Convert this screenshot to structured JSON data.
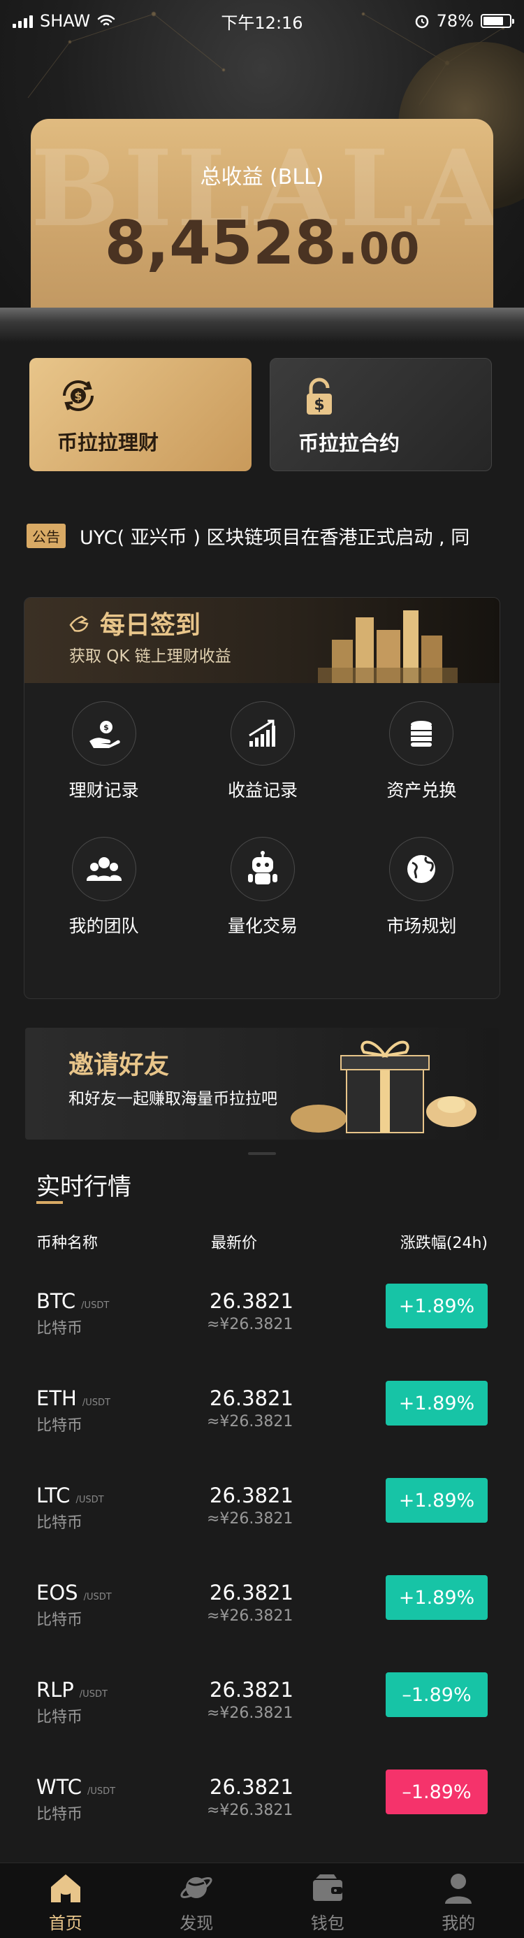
{
  "status": {
    "carrier": "SHAW",
    "time": "下午12:16",
    "battery": "78%",
    "battery_level": 0.78
  },
  "hero": {
    "watermark": "BILALA",
    "label": "总收益 (BLL)",
    "value_int": "8,4528.",
    "value_dec": "00"
  },
  "products": [
    {
      "label": "币拉拉理财",
      "icon": "dollar-cycle-icon"
    },
    {
      "label": "币拉拉合约",
      "icon": "lock-dollar-icon"
    }
  ],
  "notice": {
    "tag": "公告",
    "text": "UYC( 亚兴币 ) 区块链项目在香港正式启动 , 同"
  },
  "signin": {
    "title": "每日签到",
    "subtitle": "获取 QK 链上理财收益"
  },
  "grid": [
    {
      "label": "理财记录",
      "icon": "hand-coin-icon"
    },
    {
      "label": "收益记录",
      "icon": "growth-chart-icon"
    },
    {
      "label": "资产兑换",
      "icon": "coin-stack-icon"
    },
    {
      "label": "我的团队",
      "icon": "team-icon"
    },
    {
      "label": "量化交易",
      "icon": "robot-icon"
    },
    {
      "label": "市场规划",
      "icon": "globe-icon"
    }
  ],
  "invite": {
    "title": "邀请好友",
    "subtitle": "和好友一起赚取海量币拉拉吧"
  },
  "market": {
    "title": "实时行情",
    "headers": {
      "name": "币种名称",
      "price": "最新价",
      "change": "涨跌幅(24h)"
    },
    "rows": [
      {
        "symbol": "BTC",
        "unit": "/USDT",
        "name": "比特币",
        "price": "26.3821",
        "cny": "≈¥26.3821",
        "change": "+1.89%",
        "color": "#17c4a6"
      },
      {
        "symbol": "ETH",
        "unit": "/USDT",
        "name": "比特币",
        "price": "26.3821",
        "cny": "≈¥26.3821",
        "change": "+1.89%",
        "color": "#17c4a6"
      },
      {
        "symbol": "LTC",
        "unit": "/USDT",
        "name": "比特币",
        "price": "26.3821",
        "cny": "≈¥26.3821",
        "change": "+1.89%",
        "color": "#17c4a6"
      },
      {
        "symbol": "EOS",
        "unit": "/USDT",
        "name": "比特币",
        "price": "26.3821",
        "cny": "≈¥26.3821",
        "change": "+1.89%",
        "color": "#17c4a6"
      },
      {
        "symbol": "RLP",
        "unit": "/USDT",
        "name": "比特币",
        "price": "26.3821",
        "cny": "≈¥26.3821",
        "change": "–1.89%",
        "color": "#17c4a6"
      },
      {
        "symbol": "WTC",
        "unit": "/USDT",
        "name": "比特币",
        "price": "26.3821",
        "cny": "≈¥26.3821",
        "change": "–1.89%",
        "color": "#f5336b"
      }
    ]
  },
  "tabs": [
    {
      "label": "首页",
      "icon": "home-icon",
      "active": true
    },
    {
      "label": "发现",
      "icon": "planet-icon",
      "active": false
    },
    {
      "label": "钱包",
      "icon": "wallet-icon",
      "active": false
    },
    {
      "label": "我的",
      "icon": "user-icon",
      "active": false
    }
  ],
  "colors": {
    "gold": "#e8c58a",
    "up": "#17c4a6",
    "down": "#f5336b",
    "background": "#1b1b1b"
  }
}
